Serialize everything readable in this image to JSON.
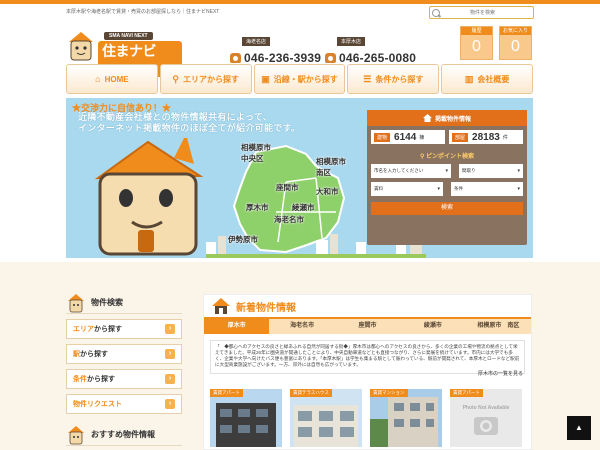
{
  "header": {
    "tagline": "本厚木駅や海老名駅で賃貸・売買のお部屋探しなら｜住まナビNEXT",
    "logo_sub": "SMA NAVI NEXT",
    "logo_main": "住まナビNEXT",
    "stores": [
      {
        "name": "海老名店",
        "phone": "046-236-3939"
      },
      {
        "name": "本厚木店",
        "phone": "046-265-0080"
      }
    ],
    "search_placeholder": "物件を検索",
    "counters": [
      {
        "label": "履歴",
        "value": "0"
      },
      {
        "label": "お気に入り",
        "value": "0"
      }
    ]
  },
  "nav": [
    {
      "label": "HOME",
      "icon": "home-icon"
    },
    {
      "label": "エリアから探す",
      "icon": "pin-icon"
    },
    {
      "label": "沿線・駅から探す",
      "icon": "train-icon"
    },
    {
      "label": "条件から探す",
      "icon": "checklist-icon"
    },
    {
      "label": "会社概要",
      "icon": "building-icon"
    }
  ],
  "hero": {
    "title": "★交渉力に自信あり！★",
    "text_line1": "近隣不動産会社様との物件情報共有によって、",
    "text_line2": "インターネット掲載物件のほぼ全てが紹介可能です。",
    "cities": [
      "相模原市\n中央区",
      "相模原市\n南区",
      "座間市",
      "大和市",
      "綾瀬市",
      "厚木市",
      "海老名市",
      "伊勢原市"
    ]
  },
  "panel": {
    "title": "掲載物件情報",
    "stats": [
      {
        "key": "建物",
        "value": "6144",
        "unit": "棟"
      },
      {
        "key": "部屋",
        "value": "28183",
        "unit": "件"
      }
    ],
    "pinpoint_title": "ピンポイント検索",
    "selects": [
      {
        "value": "市名を入力してください"
      },
      {
        "value": "間取り"
      },
      {
        "value": "賃料"
      },
      {
        "value": "条件"
      }
    ],
    "search_label": "検索"
  },
  "sidebar": {
    "title": "物件検索",
    "items": [
      {
        "hl": "エリア",
        "rest": "から探す"
      },
      {
        "hl": "駅",
        "rest": "から探す"
      },
      {
        "hl": "条件",
        "rest": "から探す"
      },
      {
        "hl": "物件リクエスト",
        "rest": ""
      }
    ],
    "title2": "おすすめ物件情報"
  },
  "news": {
    "title": "新着物件情報",
    "tabs": [
      "厚木市",
      "海老名市",
      "座間市",
      "綾瀬市",
      "相模原市　南区"
    ],
    "active_tab": 0,
    "desc_left": "「　◆都心へのアクセスの良さと緑あふれる自然が同居する街◆」厚木市は都心へのアクセスの良さから、多くの企業の工場や物流の拠点として栄えてきました。平成26年に圏央道が開通したことにより、中央自動車道などとも直接つながり、さらに発展を続けています。市内には大学でも多く、企業や大学へ向けたバス便も豊富にあります。「本厚木駅」は学生も集まる駅として賑わっている、駅前が開発されて、本厚木とロードなど駅前に大型商業施設がございます。一方、郊外には自然も広がっています。",
    "more_label": "厚木市の一覧を見る",
    "cards": [
      {
        "tag": "賃貸アパート"
      },
      {
        "tag": "賃貸テラスハウス"
      },
      {
        "tag": "賃貸マンション"
      },
      {
        "tag": "賃貸アパート",
        "placeholder": "Photo Not Available"
      }
    ]
  },
  "totop_label": "▲"
}
